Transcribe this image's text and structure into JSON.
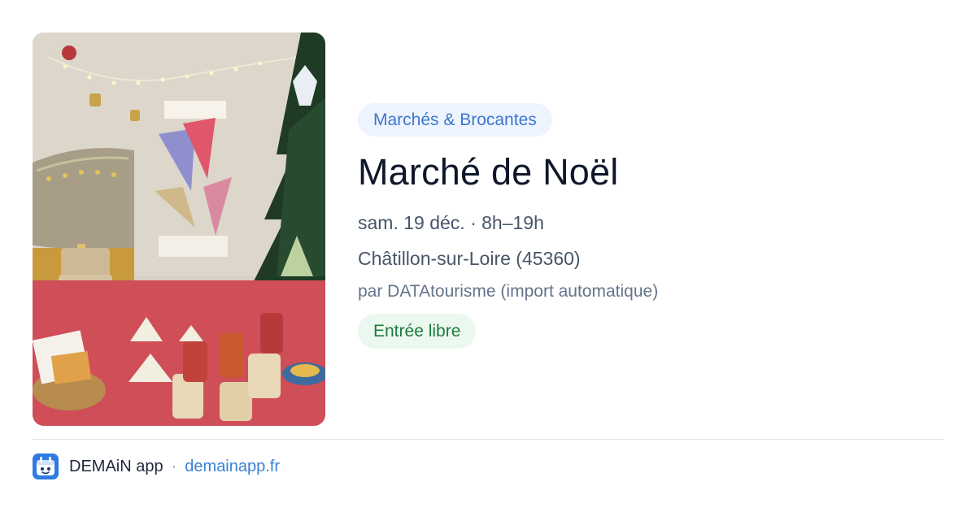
{
  "event": {
    "image_alt": "Stand du marché de Noël avec sapin et décorations",
    "category": "Marchés & Brocantes",
    "title": "Marché de Noël",
    "date_time": "sam. 19 déc. · 8h–19h",
    "location": "Châtillon-sur-Loire (45360)",
    "source": "par DATAtourisme (import automatique)",
    "price_badge": "Entrée libre"
  },
  "footer": {
    "app_name": "DEMAiN app",
    "separator": "·",
    "site": "demainapp.fr",
    "logo_icon": "demain-logo-icon"
  },
  "colors": {
    "accent_blue": "#3b76cf",
    "category_bg": "#eef4fd",
    "free_green": "#1d7a3b",
    "free_bg": "#ebf8ef"
  }
}
